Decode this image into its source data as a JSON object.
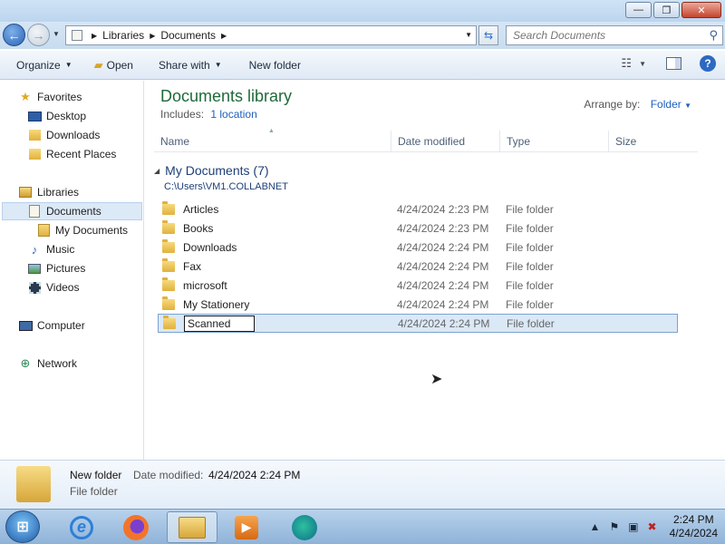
{
  "window": {
    "minimize_label": "—",
    "maximize_label": "❐",
    "close_label": "✕"
  },
  "address": {
    "breadcrumbs": [
      "Libraries",
      "Documents"
    ],
    "search_placeholder": "Search Documents"
  },
  "toolbar": {
    "organize": "Organize",
    "open": "Open",
    "share_with": "Share with",
    "new_folder": "New folder"
  },
  "nav": {
    "favorites": "Favorites",
    "desktop": "Desktop",
    "downloads": "Downloads",
    "recent_places": "Recent Places",
    "libraries": "Libraries",
    "documents": "Documents",
    "my_documents": "My Documents",
    "music": "Music",
    "pictures": "Pictures",
    "videos": "Videos",
    "computer": "Computer",
    "network": "Network"
  },
  "library": {
    "title": "Documents library",
    "includes_label": "Includes:",
    "includes_link": "1 location",
    "arrange_label": "Arrange by:",
    "arrange_value": "Folder"
  },
  "columns": {
    "name": "Name",
    "date_modified": "Date modified",
    "type": "Type",
    "size": "Size"
  },
  "group": {
    "title": "My Documents (7)",
    "path": "C:\\Users\\VM1.COLLABNET"
  },
  "files": [
    {
      "name": "Articles",
      "date": "4/24/2024 2:23 PM",
      "type": "File folder"
    },
    {
      "name": "Books",
      "date": "4/24/2024 2:23 PM",
      "type": "File folder"
    },
    {
      "name": "Downloads",
      "date": "4/24/2024 2:24 PM",
      "type": "File folder"
    },
    {
      "name": "Fax",
      "date": "4/24/2024 2:24 PM",
      "type": "File folder"
    },
    {
      "name": "microsoft",
      "date": "4/24/2024 2:24 PM",
      "type": "File folder"
    },
    {
      "name": "My Stationery",
      "date": "4/24/2024 2:24 PM",
      "type": "File folder"
    },
    {
      "name": "Scanned",
      "date": "4/24/2024 2:24 PM",
      "type": "File folder"
    }
  ],
  "details": {
    "name": "New folder",
    "date_label": "Date modified:",
    "date_value": "4/24/2024 2:24 PM",
    "type": "File folder"
  },
  "taskbar": {
    "time": "2:24 PM",
    "date": "4/24/2024"
  }
}
